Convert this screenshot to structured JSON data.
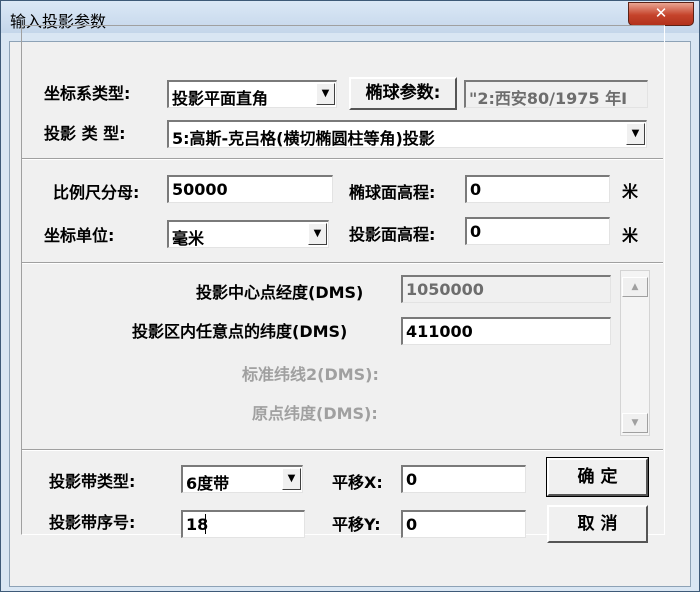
{
  "window": {
    "title": "输入投影参数",
    "close_icon": "✕"
  },
  "coord_system": {
    "label": "坐标系类型:",
    "selected": "投影平面直角",
    "ellipsoid_button": "椭球参数:",
    "ellipsoid_value": "\"2:西安80/1975 年I"
  },
  "projection_type": {
    "label": "投影 类 型:",
    "selected": "5:高斯-克吕格(横切椭圆柱等角)投影"
  },
  "scale": {
    "label": "比例尺分母:",
    "value": "50000"
  },
  "ellipsoid_height": {
    "label": "椭球面高程:",
    "value": "0",
    "unit": "米"
  },
  "coord_unit": {
    "label": "坐标单位:",
    "selected": "毫米"
  },
  "projection_height": {
    "label": "投影面高程:",
    "value": "0",
    "unit": "米"
  },
  "params": {
    "center_longitude": {
      "label": "投影中心点经度(DMS)",
      "value": "1050000"
    },
    "latitude": {
      "label": "投影区内任意点的纬度(DMS)",
      "value": "411000"
    },
    "std_parallel2": {
      "label": "标准纬线2(DMS):"
    },
    "origin_latitude": {
      "label": "原点纬度(DMS):"
    }
  },
  "zone_type": {
    "label": "投影带类型:",
    "selected": "6度带"
  },
  "zone_number": {
    "label": "投影带序号:",
    "value": "18"
  },
  "offset_x": {
    "label": "平移X:",
    "value": "0"
  },
  "offset_y": {
    "label": "平移Y:",
    "value": "0"
  },
  "ok_button": "确 定",
  "cancel_button": "取 消",
  "icons": {
    "dropdown": "▼",
    "scroll_up": "▲",
    "scroll_down": "▼"
  }
}
